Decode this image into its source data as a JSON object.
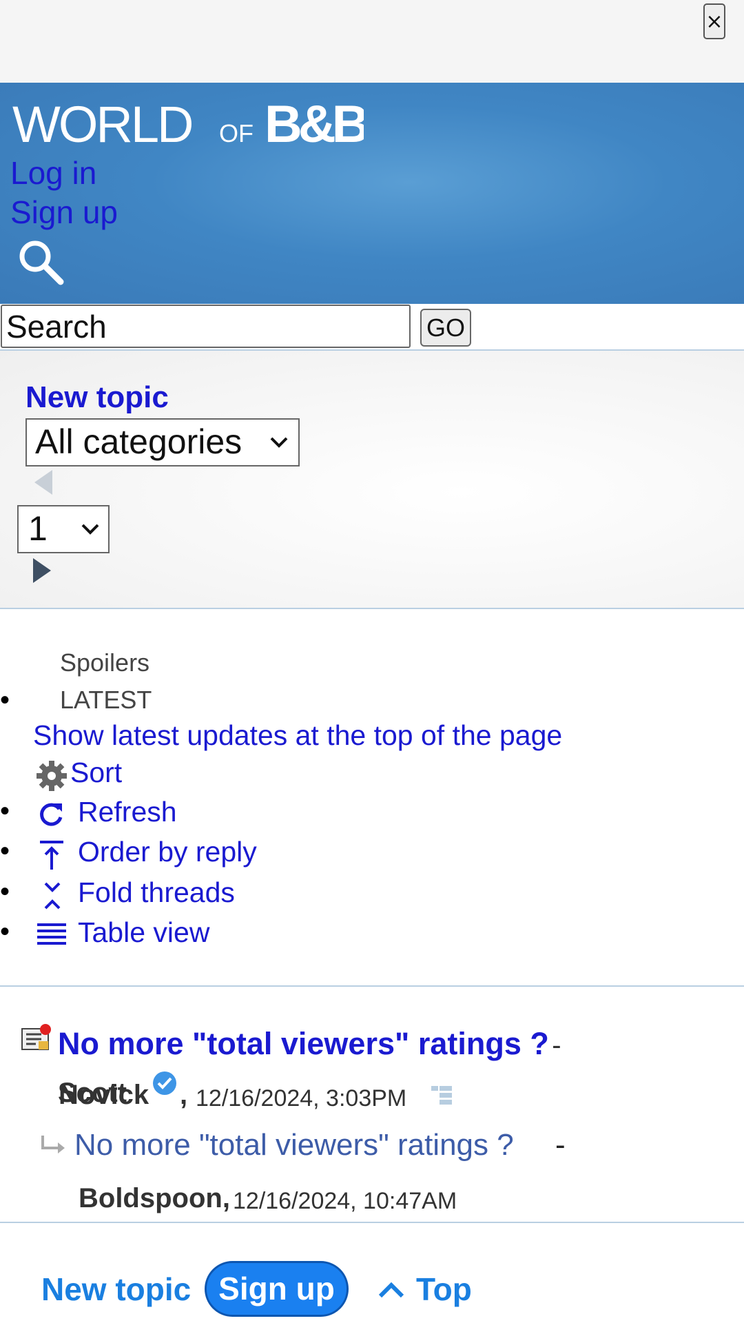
{
  "topbar": {
    "close_label": "×"
  },
  "header": {
    "logo_text_world": "WORLD",
    "logo_text_of": "OF",
    "logo_text_bb": "B&B",
    "login_label": "Log in",
    "signup_label": "Sign up",
    "search_icon": "search-icon"
  },
  "search": {
    "value": "Search",
    "go_label": "GO"
  },
  "controls": {
    "new_topic_label": "New topic",
    "category_selected": "All categories",
    "page_selected": "1",
    "prev_icon": "triangle-left-icon",
    "next_icon": "triangle-right-icon"
  },
  "options": {
    "spoilers_label": "Spoilers",
    "latest_label": "LATEST",
    "latest_description": "Show latest updates at the top of the page",
    "sort_label": "Sort",
    "items": [
      {
        "label": "Refresh",
        "icon": "refresh-icon"
      },
      {
        "label": "Order by reply",
        "icon": "order-by-reply-icon"
      },
      {
        "label": "Fold threads",
        "icon": "fold-icon"
      },
      {
        "label": "Table view",
        "icon": "table-view-icon"
      }
    ]
  },
  "threads": [
    {
      "title": "No more \"total viewers\" ratings ?",
      "author_first": "Scott",
      "author_last": "Novick",
      "date": "12/16/2024, 3:03PM",
      "verified": true,
      "replies": [
        {
          "title": "No more \"total viewers\" ratings ?",
          "author": "Boldspoon",
          "date": "12/16/2024, 10:47AM"
        }
      ]
    }
  ],
  "footer": {
    "new_topic_label": "New topic",
    "signup_label": "Sign up",
    "top_label": "Top"
  },
  "colors": {
    "header_blue": "#4086c4",
    "link_blue": "#1a1ad0",
    "footer_blue": "#1a7fe0",
    "divider": "#b9cfe2"
  }
}
